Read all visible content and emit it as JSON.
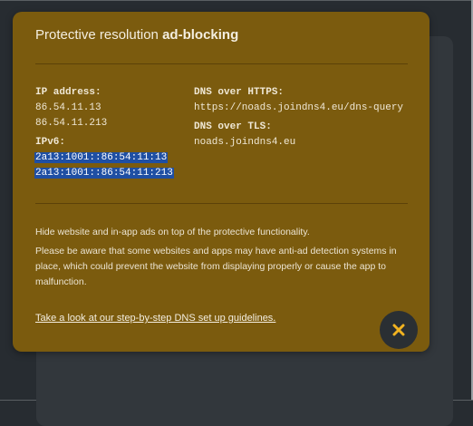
{
  "dialog": {
    "title_prefix": "Protective resolution ",
    "title_bold": "ad-blocking",
    "ip": {
      "label": "IP address:",
      "addresses": [
        "86.54.11.13",
        "86.54.11.213"
      ]
    },
    "ipv6": {
      "label": "IPv6:",
      "addresses": [
        "2a13:1001::86:54:11:13",
        "2a13:1001::86:54:11:213"
      ]
    },
    "doh": {
      "label": "DNS over HTTPS:",
      "value": "https://noads.joindns4.eu/dns-query"
    },
    "dot": {
      "label": "DNS over TLS:",
      "value": "noads.joindns4.eu"
    },
    "description": [
      "Hide website and in-app ads on top of the protective functionality.",
      "Please be aware that some websites and apps may have anti-ad detection systems in place, which could prevent the website from displaying properly or cause the app to malfunction."
    ],
    "guide_link": "Take a look at our step-by-step DNS set up guidelines.",
    "close_icon": "close-icon"
  },
  "colors": {
    "card_background": "#7b5b0e",
    "page_background": "#272c31",
    "selection": "#1f4fa3",
    "close_icon": "#f2b320"
  }
}
